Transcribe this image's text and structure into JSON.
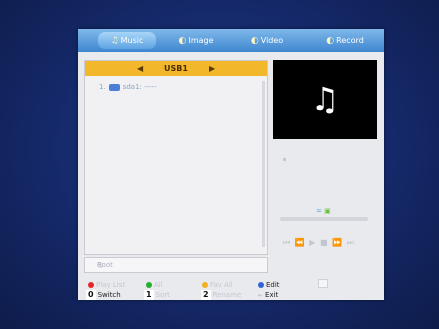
{
  "tabs": [
    {
      "label": "Music",
      "icon": "music-note-icon",
      "active": true
    },
    {
      "label": "Image",
      "icon": "image-icon",
      "active": false
    },
    {
      "label": "Video",
      "icon": "video-icon",
      "active": false
    },
    {
      "label": "Record",
      "icon": "record-icon",
      "active": false
    }
  ],
  "browser": {
    "device": "USB1",
    "items": [
      {
        "index": "1.",
        "name": "sda1: -----"
      }
    ],
    "path": "Root"
  },
  "player": {
    "repeat_indicator": "="
  },
  "footer": {
    "red": "Play List",
    "green": "All",
    "yellow": "Fav All",
    "blue": "Edit",
    "switch_key": "0",
    "switch_label": "Switch",
    "key1": "1",
    "key1_label": "Sort",
    "key2": "2",
    "key2_label": "Rename",
    "exit_label": "Exit"
  },
  "colors": {
    "red": "#e8262a",
    "green": "#22b030",
    "yellow": "#f0b020",
    "blue": "#2f63d8"
  }
}
